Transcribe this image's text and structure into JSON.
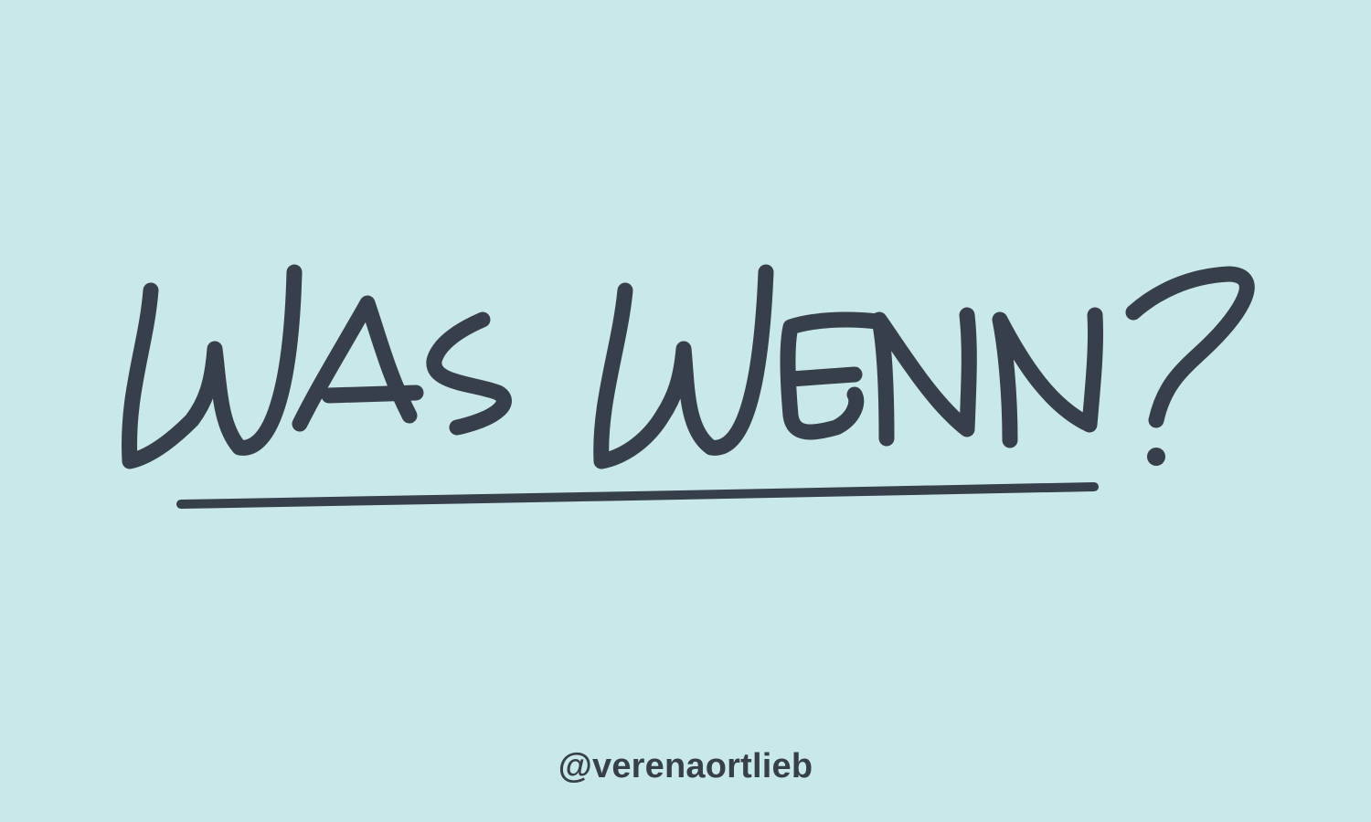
{
  "graphic": {
    "headline": "Was Wenn?",
    "handle": "@verenaortlieb"
  },
  "colors": {
    "background": "#c9e8ea",
    "ink": "#373f4a"
  }
}
